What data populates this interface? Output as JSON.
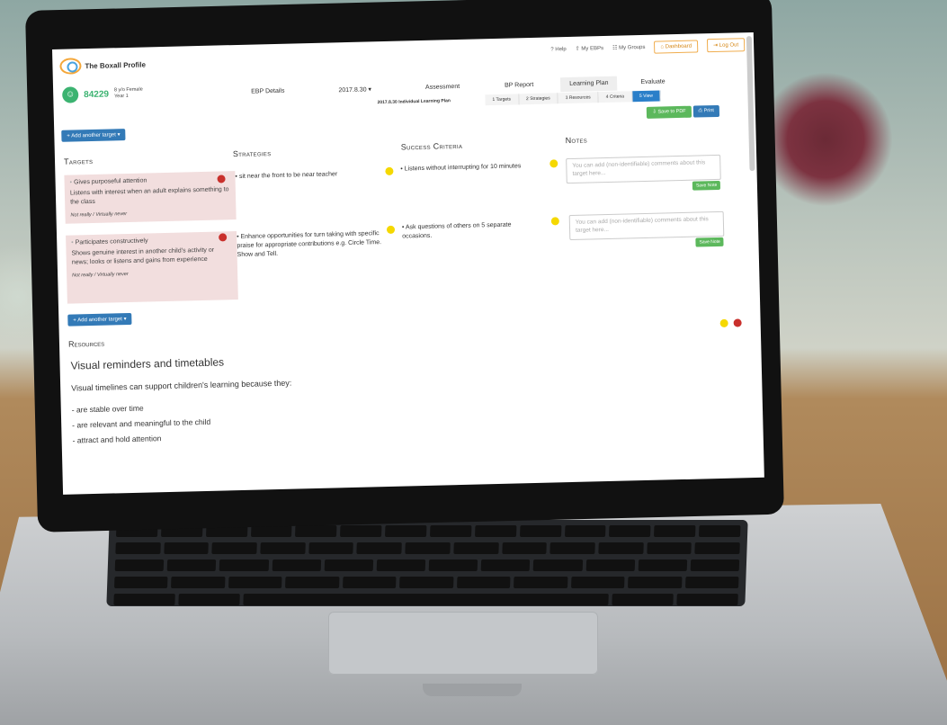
{
  "app": {
    "name": "The Boxall Profile"
  },
  "topnav": {
    "help": "Help",
    "my_ebps": "My EBPs",
    "my_groups": "My Groups",
    "dashboard": "Dashboard",
    "logout": "Log Out"
  },
  "pupil": {
    "id": "84229",
    "age_gender": "8 y/o Female",
    "year": "Year 1"
  },
  "mainnav": {
    "ebp_details": "EBP Details",
    "date": "2017.8.30 ▾",
    "assessment": "Assessment",
    "bp_report": "BP Report",
    "learning_plan": "Learning Plan",
    "evaluate": "Evaluate"
  },
  "subnav": {
    "plan_label": "2017.8.30 Individual Learning Plan",
    "steps": [
      {
        "num": "1",
        "label": "Targets"
      },
      {
        "num": "2",
        "label": "Strategies"
      },
      {
        "num": "3",
        "label": "Resources"
      },
      {
        "num": "4",
        "label": "Criteria"
      },
      {
        "num": "5",
        "label": "View"
      }
    ]
  },
  "actions": {
    "save_pdf": "Save to PDF",
    "print": "Print"
  },
  "add_target": "+ Add another target ▾",
  "columns": {
    "targets": "Targets",
    "strategies": "Strategies",
    "success": "Success Criteria",
    "notes": "Notes"
  },
  "rows": [
    {
      "target_title": "Gives purposeful attention",
      "target_desc": "Listens with interest when an adult explains something to the class",
      "rating": "Not really / Virtually never",
      "strategy": "sit near the front to be near teacher",
      "criteria": "Listens without interrupting for 10 minutes",
      "note_placeholder": "You can add (non-identifiable) comments about this target here...",
      "save_note": "Save Note"
    },
    {
      "target_title": "Participates constructively",
      "target_desc": "Shows genuine interest in another child's activity or news; looks or listens and gains from experience",
      "rating": "Not really / Virtually never",
      "strategy": "Enhance opportunities for turn taking with specific praise for appropriate contributions e.g. Circle Time. Show and Tell.",
      "criteria": "Ask questions of others on 5 separate occasions.",
      "note_placeholder": "You can add (non-identifiable) comments about this target here...",
      "save_note": "Save Note"
    }
  ],
  "resources": {
    "heading": "Resources",
    "title": "Visual reminders and timetables",
    "intro": "Visual timelines can support children's learning because they:",
    "items": [
      "- are stable over time",
      "- are relevant and meaningful to the child",
      "- attract and hold attention"
    ]
  },
  "colors": {
    "primary": "#337ab7",
    "success": "#5cb85c",
    "target_bg": "#f2dede",
    "danger": "#c9302c",
    "warning": "#f5d800"
  }
}
